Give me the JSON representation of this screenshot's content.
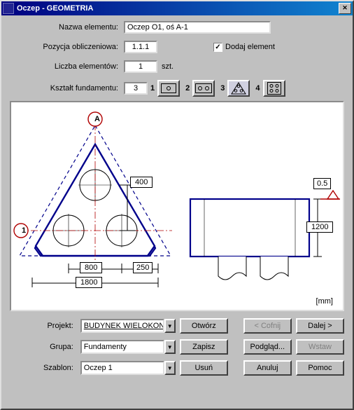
{
  "window": {
    "title": "Oczep - GEOMETRIA",
    "close_symbol": "✕"
  },
  "form": {
    "name_label": "Nazwa elementu:",
    "name_value": "Oczep O1, oś A-1",
    "pos_label": "Pozycja obliczeniowa:",
    "pos_value": "1.1.1",
    "add_element_label": "Dodaj element",
    "add_element_checked": "✓",
    "count_label": "Liczba elementów:",
    "count_value": "1",
    "count_unit": "szt.",
    "shape_label": "Kształt fundamentu:",
    "shape_value": "3",
    "shape_nums": {
      "n1": "1",
      "n2": "2",
      "n3": "3",
      "n4": "4"
    }
  },
  "drawing": {
    "axis_marker": "A",
    "side_marker": "1",
    "dim_top": "400",
    "dim_bottom_mid": "800",
    "dim_bottom_right": "250",
    "dim_bottom_total": "1800",
    "rect_h": "1200",
    "level": "0.5",
    "units": "[mm]"
  },
  "bottom": {
    "project_label": "Projekt:",
    "project_value": "BUDYNEK WIELOKOND",
    "group_label": "Grupa:",
    "group_value": "Fundamenty",
    "template_label": "Szablon:",
    "template_value": "Oczep 1",
    "btn_open": "Otwórz",
    "btn_save": "Zapisz",
    "btn_delete": "Usuń",
    "btn_undo": "< Cofnij",
    "btn_next": "Dalej >",
    "btn_preview": "Podgląd...",
    "btn_insert": "Wstaw",
    "btn_close": "Anuluj",
    "btn_help": "Pomoc"
  }
}
